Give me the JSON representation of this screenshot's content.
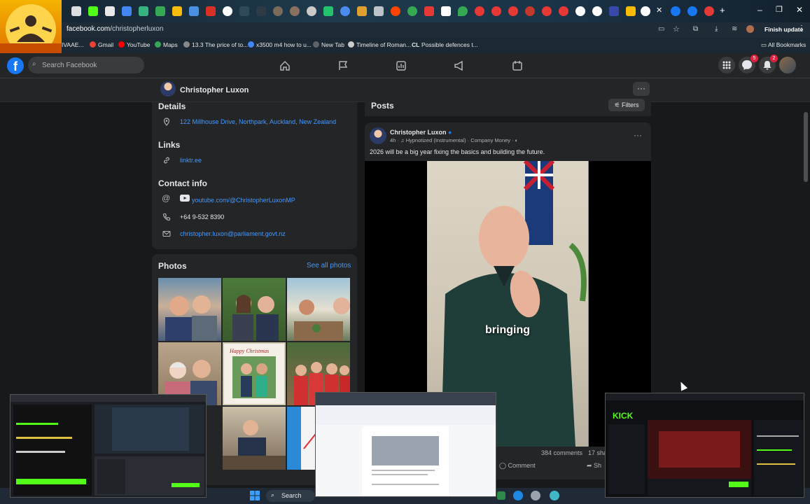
{
  "browser": {
    "url_host": "facebook.com",
    "url_path": "/christopherluxon",
    "finish_update": "Finish update",
    "all_bookmarks": "All Bookmarks",
    "bookmarks": [
      {
        "label": "IVAAE...",
        "color": "#c9a227"
      },
      {
        "label": "Gmail",
        "color": "#ea4335"
      },
      {
        "label": "YouTube",
        "color": "#ff0000"
      },
      {
        "label": "Maps",
        "color": "#34a853"
      },
      {
        "label": "13.3 The price of to...",
        "color": "#888888"
      },
      {
        "label": "x3500 m4 how to u...",
        "color": "#4285f4"
      },
      {
        "label": "New Tab",
        "color": "#5f6368"
      },
      {
        "label": "Timeline of Roman...",
        "color": "#cccccc"
      },
      {
        "label": "Possible defences t...",
        "color": "#333333"
      }
    ],
    "bookmark_cl": "CL"
  },
  "facebook": {
    "search_placeholder": "Search Facebook",
    "notification_count": "2",
    "messenger_count": "5",
    "logo_letter": "f"
  },
  "profile": {
    "name": "Christopher Luxon",
    "details_title": "Details",
    "address": "122 Millhouse Drive, Northpark, Auckland, New Zealand",
    "links_title": "Links",
    "link": "linktr.ee",
    "contact_title": "Contact info",
    "youtube": "youtube.com/@ChristopherLuxonMP",
    "phone": "+64 9-532 8390",
    "email": "christopher.luxon@parliament.govt.nz",
    "photos_title": "Photos",
    "see_all_photos": "See all photos",
    "photo_card_text": "Happy Christmas"
  },
  "posts": {
    "title": "Posts",
    "filters": "Filters",
    "author": "Christopher Luxon",
    "meta": "4h · ♫ Hypnotized (Instrumental) · Company Money · ◐",
    "text": "2026 will be a big year fixing the basics and building the future.",
    "video_caption": "bringing",
    "comments": "384 comments",
    "shares": "17 sha",
    "comment_btn": "Comment",
    "share_btn": "Sh"
  },
  "taskbar": {
    "search": "Search"
  },
  "colors": {
    "fb_blue": "#1877f2",
    "link_blue": "#4599ff",
    "card_bg": "#242526",
    "page_bg": "#18191a"
  }
}
